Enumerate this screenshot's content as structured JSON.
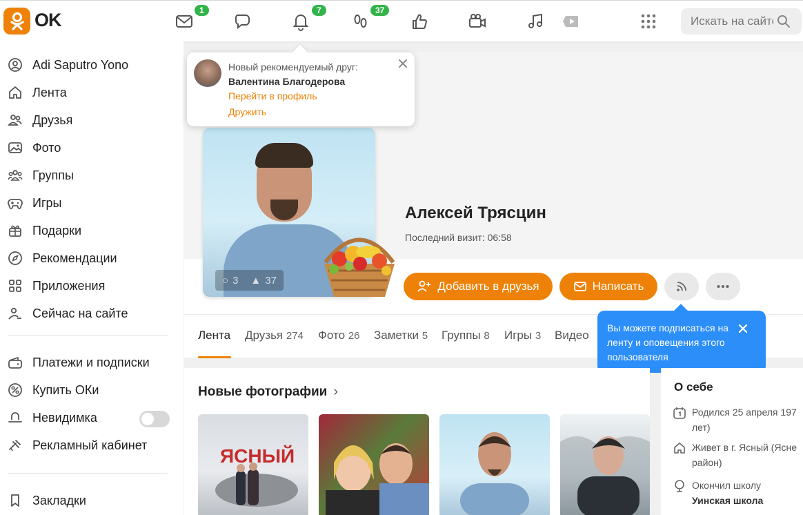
{
  "header": {
    "logo_text": "OK",
    "search_placeholder": "Искать на сайте",
    "badges": {
      "messages": "1",
      "notifications": "7",
      "guests": "37"
    }
  },
  "sidebar": {
    "items": [
      {
        "label": "Adi Saputro Yono",
        "icon": "user-circle-icon"
      },
      {
        "label": "Лента",
        "icon": "home-icon"
      },
      {
        "label": "Друзья",
        "icon": "friends-icon"
      },
      {
        "label": "Фото",
        "icon": "photo-icon"
      },
      {
        "label": "Группы",
        "icon": "groups-icon"
      },
      {
        "label": "Игры",
        "icon": "gamepad-icon"
      },
      {
        "label": "Подарки",
        "icon": "gift-icon"
      },
      {
        "label": "Рекомендации",
        "icon": "compass-icon"
      },
      {
        "label": "Приложения",
        "icon": "apps-icon"
      },
      {
        "label": "Сейчас на сайте",
        "icon": "online-users-icon"
      },
      {
        "label": "Платежи и подписки",
        "icon": "wallet-icon"
      },
      {
        "label": "Купить ОКи",
        "icon": "coin-icon"
      },
      {
        "label": "Невидимка",
        "icon": "hat-icon"
      },
      {
        "label": "Рекламный кабинет",
        "icon": "megaphone-icon"
      },
      {
        "label": "Закладки",
        "icon": "bookmark-icon"
      }
    ]
  },
  "notification": {
    "title": "Новый рекомендуемый друг:",
    "name": "Валентина Благодерова",
    "link_profile": "Перейти в профиль",
    "link_friend": "Дружить"
  },
  "profile": {
    "name": "Алексей Трясцин",
    "last_visit": "Последний визит: 06:58",
    "photo_comments": "3",
    "photo_likes": "37",
    "add_friend_label": "Добавить в друзья",
    "write_label": "Написать"
  },
  "tabs": [
    {
      "label": "Лента",
      "count": ""
    },
    {
      "label": "Друзья",
      "count": "274"
    },
    {
      "label": "Фото",
      "count": "26"
    },
    {
      "label": "Заметки",
      "count": "5"
    },
    {
      "label": "Группы",
      "count": "8"
    },
    {
      "label": "Игры",
      "count": "3"
    },
    {
      "label": "Видео",
      "count": ""
    }
  ],
  "tooltip": {
    "text": "Вы можете подписаться на ленту и оповещения этого пользователя"
  },
  "photos": {
    "title": "Новые фотографии",
    "sign_text": "ЯСНЫЙ"
  },
  "about": {
    "title": "О себе",
    "born_line1": "Родился 25 апреля 197",
    "born_line2": "лет)",
    "lives_line1": "Живет в г. Ясный (Ясне",
    "lives_line2": "район)",
    "school_line1": "Окончил школу",
    "school_line2": "Уинская школа"
  },
  "colors": {
    "accent": "#ee8208",
    "badge": "#33b44a",
    "tooltip": "#2c8ef8"
  }
}
